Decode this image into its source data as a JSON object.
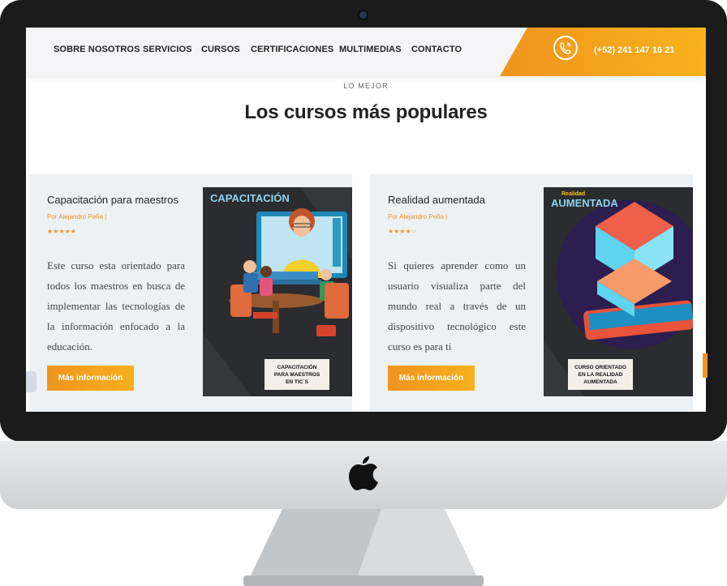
{
  "nav": {
    "items": [
      "SOBRE NOSOTROS",
      "SERVICIOS",
      "CURSOS",
      "CERTIFICACIONES",
      "MULTIMEDIAS",
      "CONTACTO"
    ],
    "phone": "(+52) 241 147 16 21"
  },
  "section": {
    "eyebrow": "LO MEJOR",
    "title": "Los cursos más populares"
  },
  "courses": [
    {
      "title": "Capacitación para maestros",
      "author": "Por Alejandro Peña |",
      "rating": 5,
      "stars_text": "★★★★★",
      "description": "Este curso esta orientado para todos los maestros en busca de implementar las tecnologías de la información enfocado a la educación.",
      "button": "Más información",
      "image": {
        "header": "CAPACITACIÓN",
        "caption_lines": [
          "CAPACITACIÓN",
          "PARA MAESTROS",
          "EN TIC´S"
        ]
      }
    },
    {
      "title": "Realidad aumentada",
      "author": "Por Alejandro Peña |",
      "rating": 4,
      "stars_text": "★★★★☆",
      "description": "Si quieres aprender como un usuario visualiza parte del mundo real a través de un dispositivo tecnológico este curso es para ti",
      "button": "Más información",
      "image": {
        "header_small": "Realidad",
        "header": "AUMENTADA",
        "caption_lines": [
          "CURSO ORIENTADO",
          "EN LA REALIDAD",
          "AUMENTADA"
        ]
      }
    }
  ],
  "colors": {
    "accent": "#f0941e",
    "accent_light": "#f7b21c",
    "card_bg": "#eef1f3",
    "frame": "#1b1b1b"
  },
  "icons": [
    "phone-icon",
    "apple-logo-icon",
    "camera-icon"
  ]
}
